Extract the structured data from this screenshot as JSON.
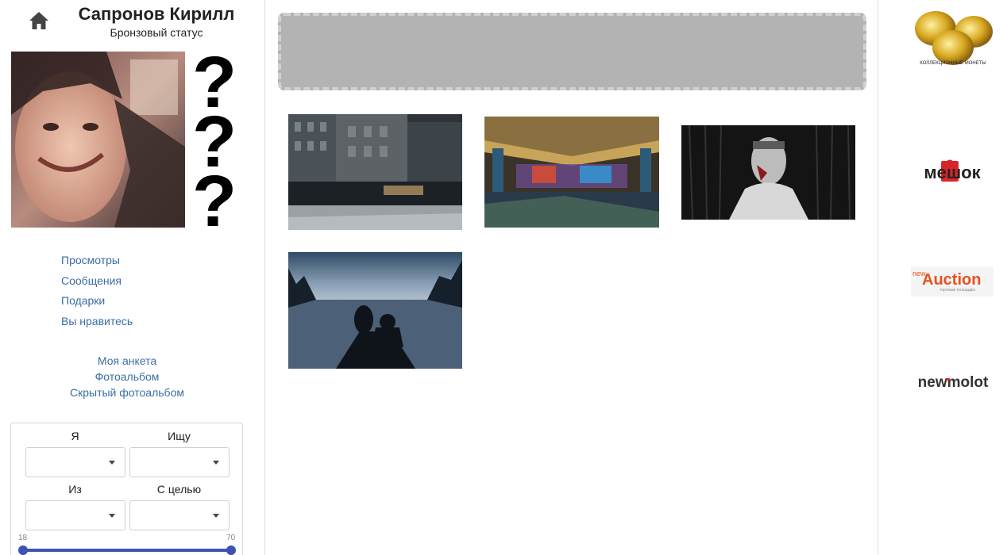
{
  "profile": {
    "name": "Сапронов Кирилл",
    "status": "Бронзовый статус"
  },
  "nav_primary": [
    {
      "label": "Просмотры"
    },
    {
      "label": "Сообщения"
    },
    {
      "label": "Подарки"
    },
    {
      "label": "Вы нравитесь"
    }
  ],
  "nav_secondary": [
    {
      "label": "Моя анкета"
    },
    {
      "label": "Фотоальбом"
    },
    {
      "label": "Скрытый фотоальбом"
    }
  ],
  "filter": {
    "i_label": "Я",
    "seek_label": "Ищу",
    "from_label": "Из",
    "purpose_label": "С целью",
    "i_value": "",
    "seek_value": "",
    "from_value": "",
    "purpose_value": "",
    "age_min": "18",
    "age_max": "70"
  },
  "partners": {
    "coins_text": "КОЛЛЕКЦИОННЫЕ МОНЕТЫ",
    "meshok_text": "мешок",
    "auction_small": "new",
    "auction_text": "Auction",
    "auction_sub": "торговая площадка",
    "molot_text": "newmolot"
  },
  "colors": {
    "link": "#3a6ea5",
    "accent": "#3f51b5",
    "banner": "#b3b3b3"
  }
}
